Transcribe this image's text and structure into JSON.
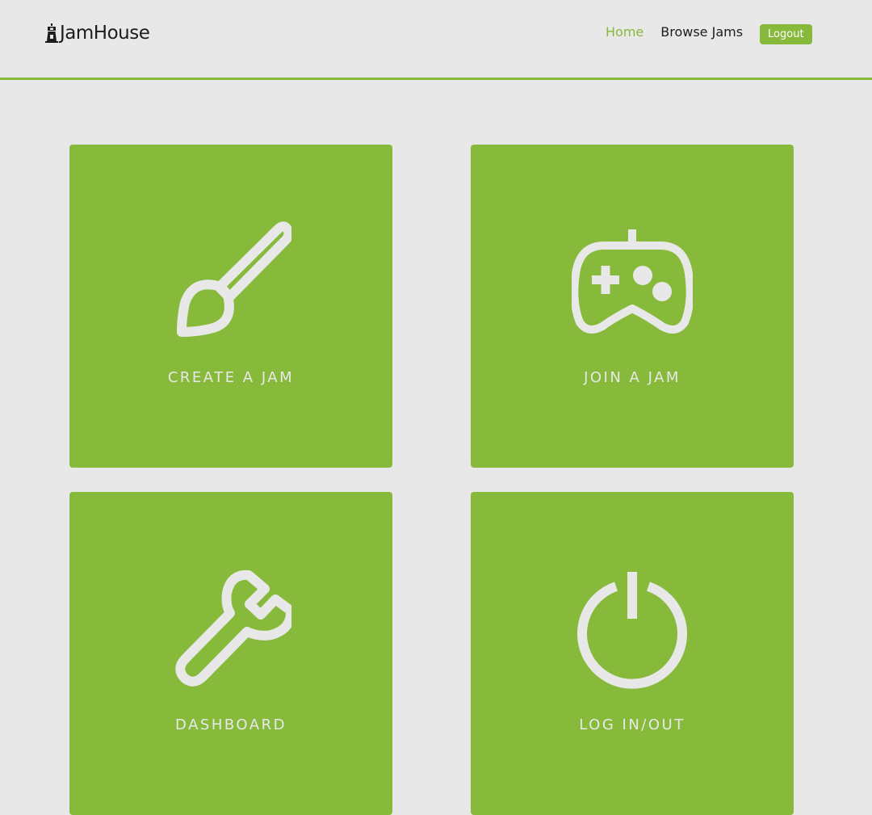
{
  "header": {
    "logo_text": "JamHouse",
    "nav": {
      "home": "Home",
      "browse": "Browse Jams"
    },
    "logout_label": "Logout"
  },
  "tiles": [
    {
      "label": "CREATE A JAM",
      "icon": "paintbrush-icon"
    },
    {
      "label": "JOIN A JAM",
      "icon": "gamepad-icon"
    },
    {
      "label": "DASHBOARD",
      "icon": "wrench-icon"
    },
    {
      "label": "LOG IN/OUT",
      "icon": "power-icon"
    }
  ],
  "colors": {
    "accent": "#87b93b",
    "background": "#e8e8e8",
    "icon": "#e8e8e8",
    "text_dark": "#1c1c1c"
  }
}
